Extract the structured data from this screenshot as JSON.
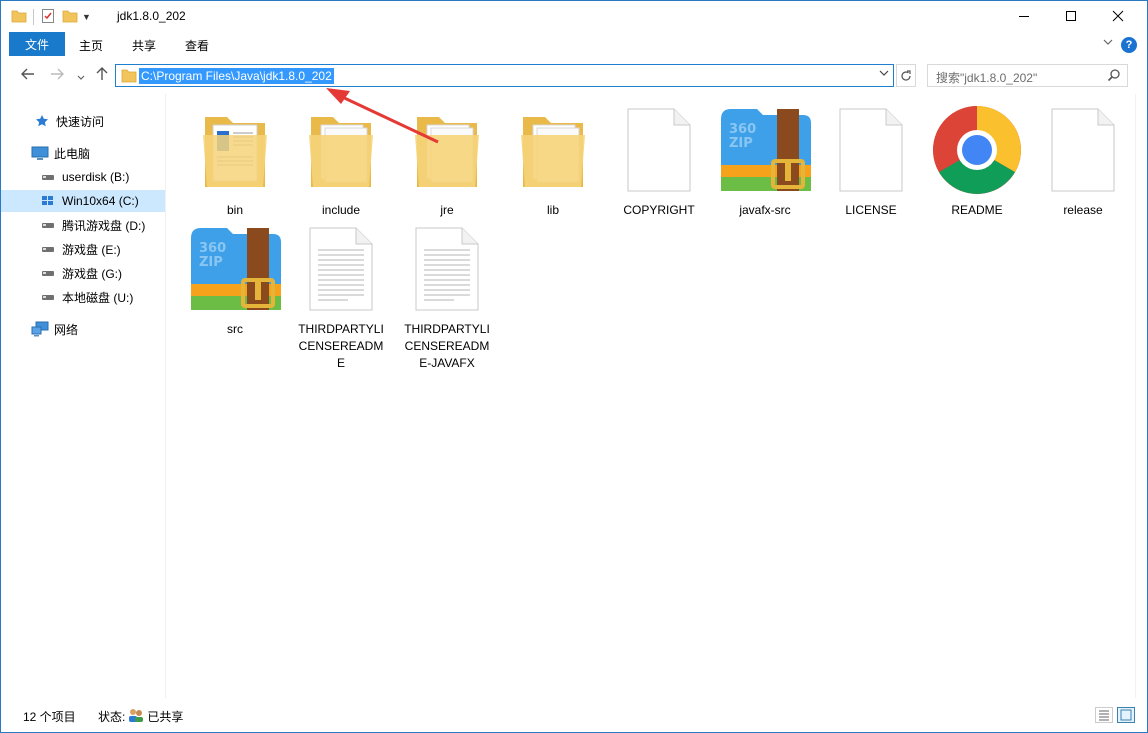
{
  "title": {
    "text": "jdk1.8.0_202"
  },
  "ribbon": {
    "tabs": [
      "文件",
      "主页",
      "共享",
      "查看"
    ]
  },
  "address": {
    "path": "C:\\Program Files\\Java\\jdk1.8.0_202"
  },
  "search": {
    "placeholder": "搜索\"jdk1.8.0_202\""
  },
  "sidebar": {
    "quick_access": "快速访问",
    "this_pc": "此电脑",
    "drives": [
      "userdisk (B:)",
      "Win10x64 (C:)",
      "腾讯游戏盘 (D:)",
      "游戏盘 (E:)",
      "游戏盘 (G:)",
      "本地磁盘 (U:)"
    ],
    "network": "网络"
  },
  "files": [
    {
      "name": "bin",
      "type": "folder-doc"
    },
    {
      "name": "include",
      "type": "folder"
    },
    {
      "name": "jre",
      "type": "folder"
    },
    {
      "name": "lib",
      "type": "folder"
    },
    {
      "name": "COPYRIGHT",
      "type": "blank-file"
    },
    {
      "name": "javafx-src",
      "type": "zip"
    },
    {
      "name": "LICENSE",
      "type": "blank-file"
    },
    {
      "name": "README",
      "type": "chrome"
    },
    {
      "name": "release",
      "type": "blank-file"
    },
    {
      "name": "src",
      "type": "zip"
    },
    {
      "name": "THIRDPARTYLICENSEREADME",
      "type": "text-file"
    },
    {
      "name": "THIRDPARTYLICENSEREADME-JAVAFX",
      "type": "text-file"
    }
  ],
  "status": {
    "count": "12 个项目",
    "state_label": "状态:",
    "state_value": "已共享"
  },
  "colors": {
    "accent": "#1979ca",
    "selection": "#cce8ff",
    "annotation": "#e53935"
  }
}
